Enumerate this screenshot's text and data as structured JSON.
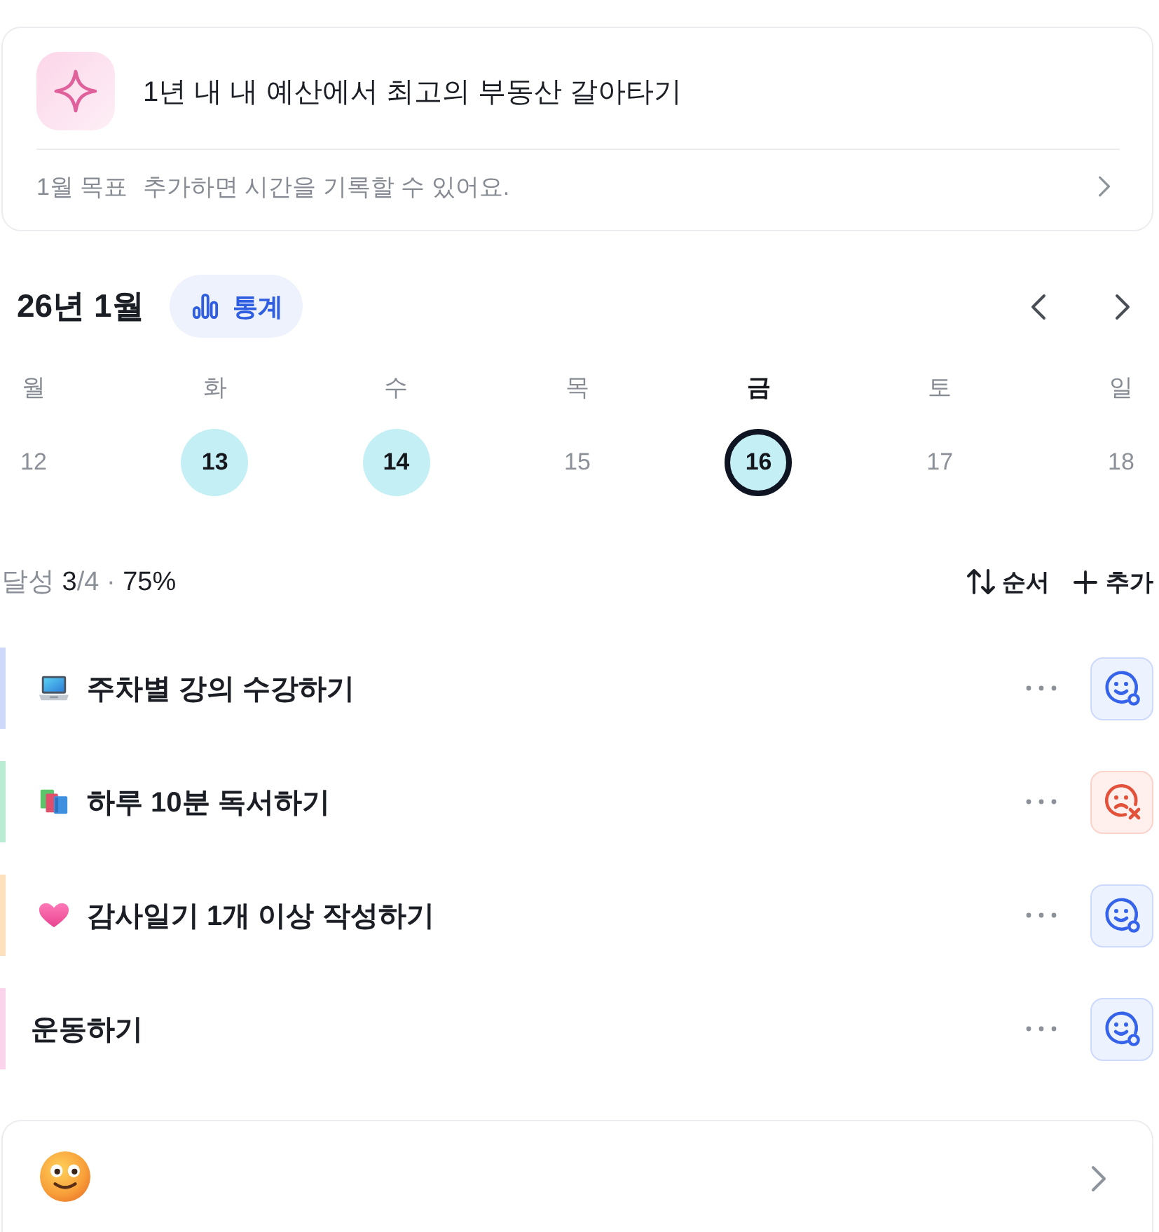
{
  "goal_card": {
    "title": "1년 내 내 예산에서 최고의 부동산 갈아타기",
    "label": "1월 목표",
    "hint": "추가하면 시간을 기록할 수 있어요."
  },
  "calendar": {
    "title": "26년 1월",
    "stats_button": "통계",
    "days": [
      {
        "weekday": "월",
        "date": "12",
        "done": false,
        "selected": false
      },
      {
        "weekday": "화",
        "date": "13",
        "done": true,
        "selected": false
      },
      {
        "weekday": "수",
        "date": "14",
        "done": true,
        "selected": false
      },
      {
        "weekday": "목",
        "date": "15",
        "done": false,
        "selected": false
      },
      {
        "weekday": "금",
        "date": "16",
        "done": true,
        "selected": true
      },
      {
        "weekday": "토",
        "date": "17",
        "done": false,
        "selected": false
      },
      {
        "weekday": "일",
        "date": "18",
        "done": false,
        "selected": false
      }
    ]
  },
  "summary": "달성 **3**/4 · **75%**",
  "actions": [
    {
      "kind": "sort",
      "label": "순서"
    },
    {
      "kind": "add",
      "label": "추가"
    }
  ],
  "tasks": [
    {
      "kind": "laptop",
      "title": "주차별 강의 수강하기",
      "color": "#cdd8fb",
      "achieved": true
    },
    {
      "kind": "books",
      "title": "하루 10분 독서하기",
      "color": "#b9ecd3",
      "achieved": false
    },
    {
      "kind": "heart",
      "title": "감사일기 1개 이상 작성하기",
      "color": "#fde1bd",
      "achieved": true
    },
    {
      "kind": "plain",
      "title": "운동하기",
      "color": "#fbd3ea",
      "achieved": true
    }
  ]
}
